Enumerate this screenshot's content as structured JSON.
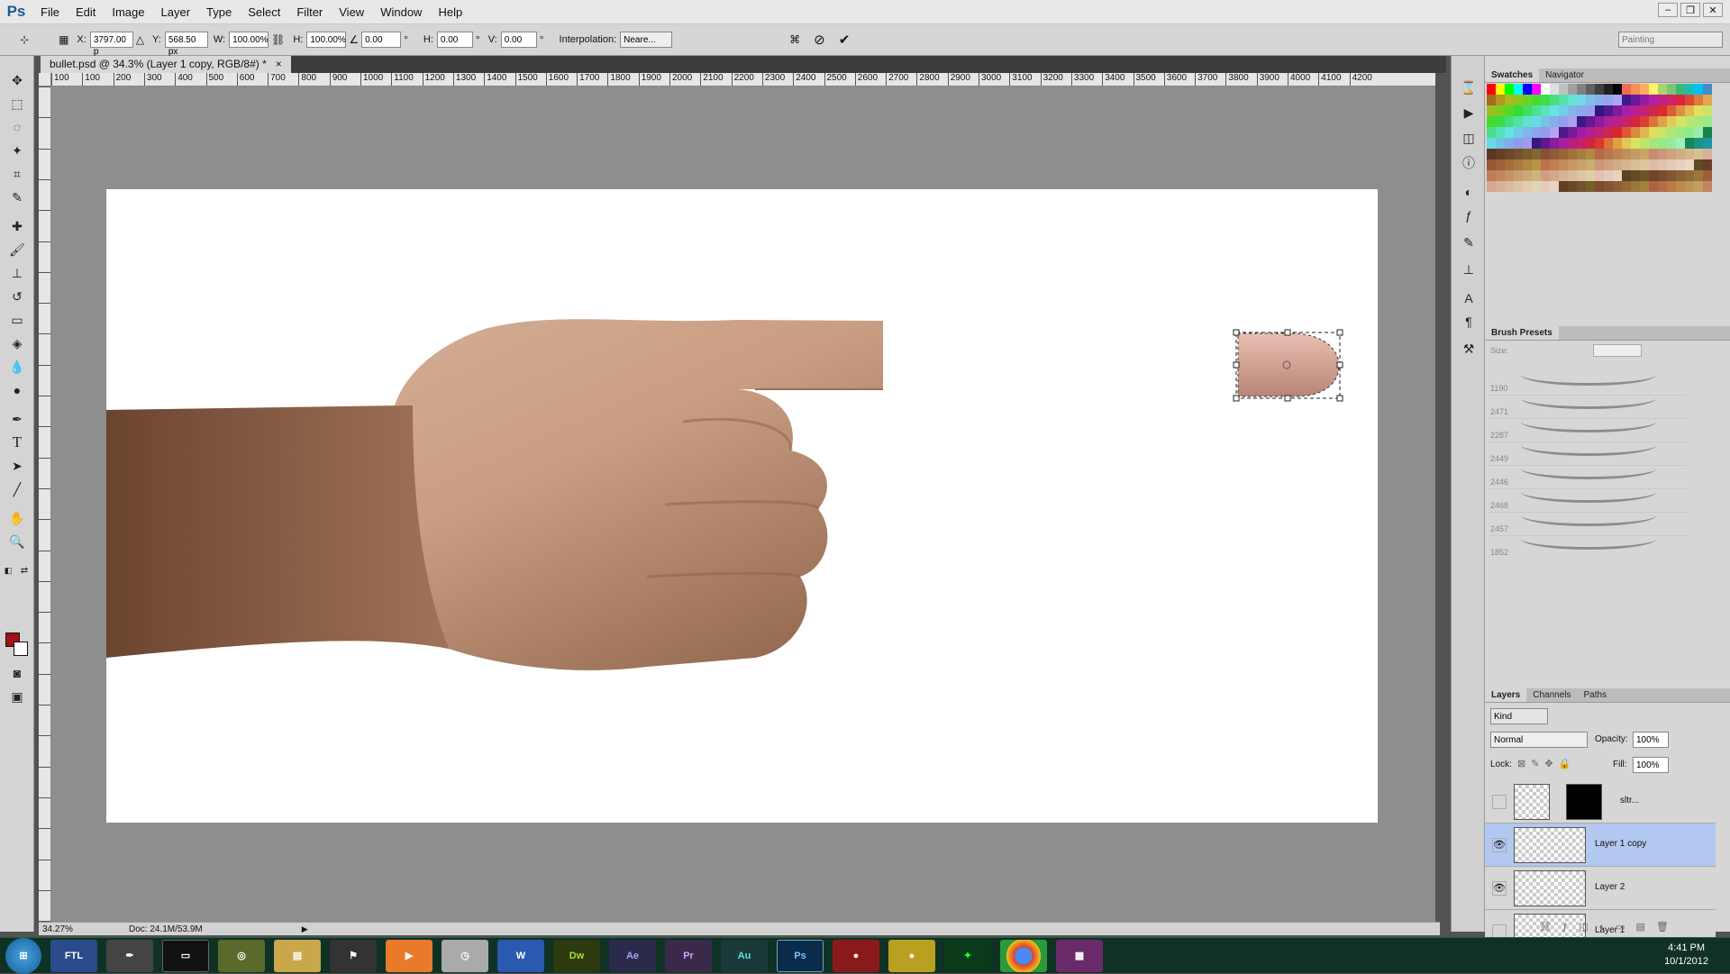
{
  "app": {
    "logo": "Ps"
  },
  "menu": [
    "File",
    "Edit",
    "Image",
    "Layer",
    "Type",
    "Select",
    "Filter",
    "View",
    "Window",
    "Help"
  ],
  "window_controls": {
    "minimize": "–",
    "restore": "❐",
    "close": "✕"
  },
  "options": {
    "x_label": "X:",
    "x_value": "3797.00 p",
    "y_label": "Y:",
    "y_value": "568.50 px",
    "w_label": "W:",
    "w_value": "100.00%",
    "h_label": "H:",
    "h_value": "100.00%",
    "angle_value": "0.00",
    "angle_unit": "°",
    "hskew_label": "H:",
    "hskew_value": "0.00",
    "hskew_unit": "°",
    "vskew_label": "V:",
    "vskew_value": "0.00",
    "vskew_unit": "°",
    "interp_label": "Interpolation:",
    "interp_value": "Neare...",
    "workspace": "Painting"
  },
  "doc": {
    "tab_title": "bullet.psd @ 34.3% (Layer 1 copy, RGB/8#) *",
    "tab_close": "×"
  },
  "ruler_ticks": [
    "100",
    "100",
    "200",
    "300",
    "400",
    "500",
    "600",
    "700",
    "800",
    "900",
    "1000",
    "1100",
    "1200",
    "1300",
    "1400",
    "1500",
    "1600",
    "1700",
    "1800",
    "1900",
    "2000",
    "2100",
    "2200",
    "2300",
    "2400",
    "2500",
    "2600",
    "2700",
    "2800",
    "2900",
    "3000",
    "3100",
    "3200",
    "3300",
    "3400",
    "3500",
    "3600",
    "3700",
    "3800",
    "3900",
    "4000",
    "4100",
    "4200"
  ],
  "status": {
    "zoom": "34.27%",
    "doc": "Doc: 24.1M/53.9M"
  },
  "panels": {
    "swatches_tab": "Swatches",
    "navigator_tab": "Navigator",
    "brush_presets_title": "Brush Presets",
    "size_label": "Size:",
    "brush_sizes": [
      "1190",
      "2471",
      "2287",
      "2449",
      "2446",
      "2468",
      "2457",
      "1852"
    ],
    "layers_tab": "Layers",
    "channels_tab": "Channels",
    "paths_tab": "Paths",
    "kind": "Kind",
    "blend_mode": "Normal",
    "opacity_label": "Opacity:",
    "opacity_value": "100%",
    "lock_label": "Lock:",
    "fill_label": "Fill:",
    "fill_value": "100%"
  },
  "layers": [
    {
      "name": "sltr...",
      "visible": false
    },
    {
      "name": "Layer 1 copy",
      "visible": true
    },
    {
      "name": "Layer 2",
      "visible": true
    },
    {
      "name": "Layer 1",
      "visible": false
    }
  ],
  "taskbar": {
    "apps": [
      "FTL",
      "Dw",
      "Ae",
      "Pr",
      "Au",
      "Ps"
    ],
    "time": "4:41 PM",
    "date": "10/1/2012"
  },
  "colors": {
    "foreground": "#a31118",
    "background": "#ffffff",
    "selection": "#b2c8f0"
  }
}
